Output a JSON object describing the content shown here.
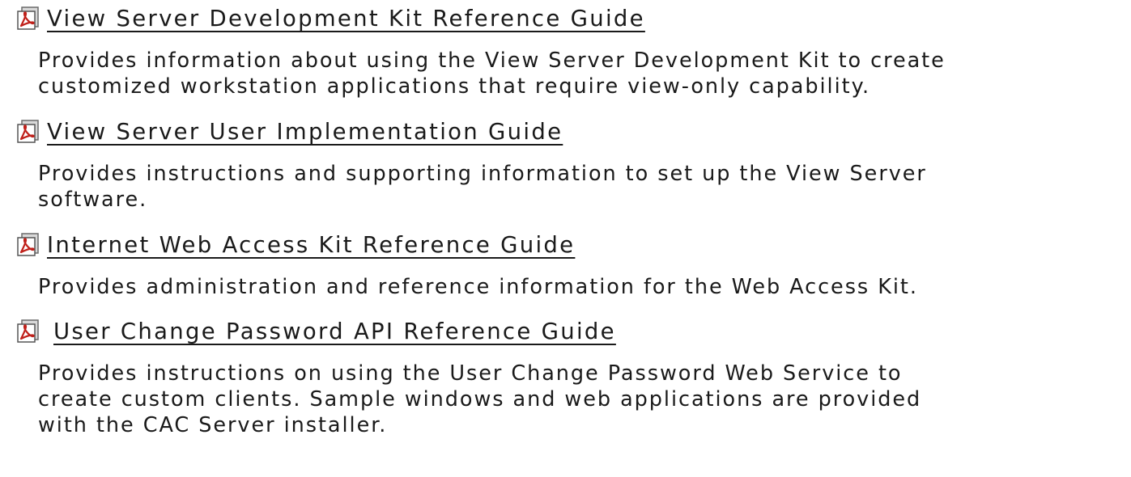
{
  "documents": [
    {
      "icon": "pdf-icon",
      "title": "View Server Development Kit Reference Guide",
      "description_lines": [
        "Provides information about using the View Server Development Kit to create",
        "customized workstation applications that require view-only capability."
      ]
    },
    {
      "icon": "pdf-icon",
      "title": "View Server User Implementation Guide",
      "description_lines": [
        "Provides instructions and supporting information to set up the View Server",
        "software."
      ]
    },
    {
      "icon": "pdf-icon",
      "title": "Internet Web Access Kit Reference Guide",
      "description_lines": [
        "Provides administration and reference information for the Web Access Kit."
      ]
    },
    {
      "icon": "pdf-icon",
      "title": "User Change Password API Reference Guide",
      "description_lines": [
        "Provides instructions on using the User Change Password Web Service to",
        "create custom clients. Sample windows and web applications are provided",
        "with the CAC Server installer."
      ]
    }
  ]
}
